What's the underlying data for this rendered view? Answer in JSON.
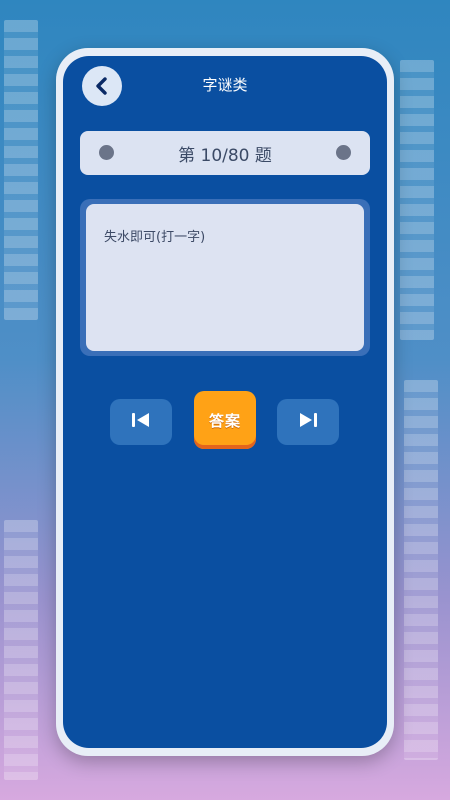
{
  "header": {
    "title": "字谜类",
    "back_icon": "chevron-left-icon"
  },
  "progress": {
    "label": "第 10/80 题",
    "current": 10,
    "total": 80
  },
  "question": {
    "text": "失水即可(打一字)"
  },
  "controls": {
    "prev_icon": "skip-previous-icon",
    "answer_label": "答案",
    "next_icon": "skip-next-icon"
  },
  "colors": {
    "screen_bg": "#0a4fa1",
    "card_bg": "#dde3f2",
    "answer_button": "#ffa216",
    "nav_button": "#2f73bc"
  }
}
